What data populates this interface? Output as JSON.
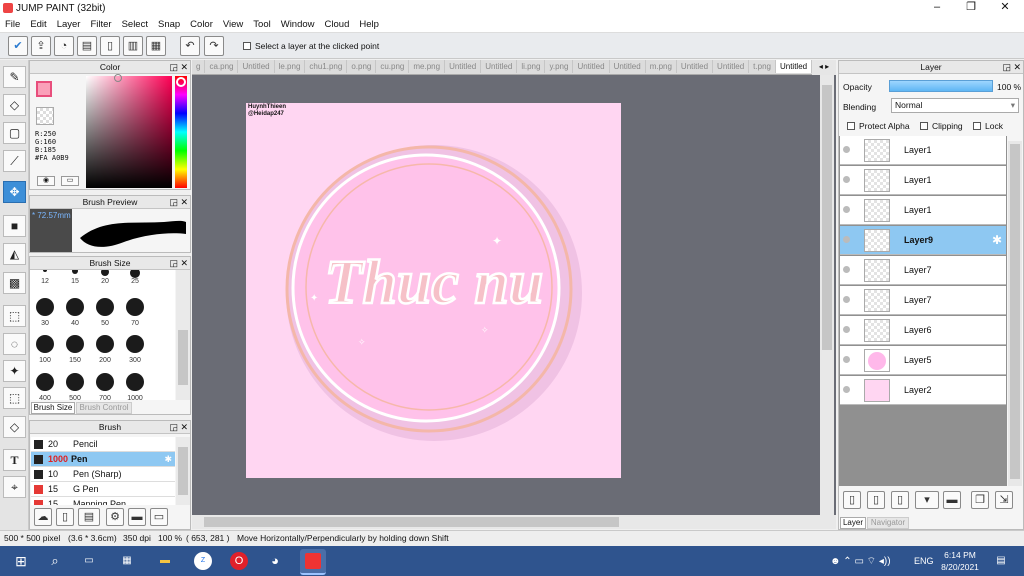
{
  "window": {
    "title": "JUMP PAINT (32bit)",
    "minimize": "–",
    "maximize": "❐",
    "close": "✕"
  },
  "menu": [
    "File",
    "Edit",
    "Layer",
    "Filter",
    "Select",
    "Snap",
    "Color",
    "View",
    "Tool",
    "Window",
    "Cloud",
    "Help"
  ],
  "toolbar": {
    "select_layer_label": "Select a layer at the clicked point"
  },
  "tabs": [
    "g",
    "ca.png",
    "Untitled",
    "le.png",
    "chu1.png",
    "o.png",
    "cu.png",
    "me.png",
    "Untitled",
    "Untitled",
    "li.png",
    "y.png",
    "Untitled",
    "Untitled",
    "m.png",
    "Untitled",
    "Untitled",
    "t.png",
    "Untitled"
  ],
  "color_panel": {
    "title": "Color",
    "r": "R:250",
    "g": "G:160",
    "b": "B:185",
    "hex": "#FA A0B9",
    "fg": "#FAA0B9"
  },
  "brush_preview": {
    "title": "Brush Preview",
    "size": "72.57mm"
  },
  "brush_size": {
    "title": "Brush Size",
    "rows": [
      [
        "12",
        "15",
        "20",
        "25"
      ],
      [
        "30",
        "40",
        "50",
        "70"
      ],
      [
        "100",
        "150",
        "200",
        "300"
      ],
      [
        "400",
        "500",
        "700",
        "1000"
      ]
    ],
    "tab_size": "Brush Size",
    "tab_control": "Brush Control"
  },
  "brush": {
    "title": "Brush",
    "items": [
      {
        "size": "20",
        "name": "Pencil",
        "color": "#222222"
      },
      {
        "size": "1000",
        "name": "Pen",
        "color": "#222222",
        "selected": true
      },
      {
        "size": "10",
        "name": "Pen (Sharp)",
        "color": "#222222"
      },
      {
        "size": "15",
        "name": "G Pen",
        "color": "#e53935"
      },
      {
        "size": "15",
        "name": "Mapping Pen",
        "color": "#e53935"
      }
    ]
  },
  "canvas": {
    "watermark1": "HuynhThieen",
    "watermark2": "@Heidap247",
    "lettering": "Thuc nu"
  },
  "layer_panel": {
    "title": "Layer",
    "opacity_label": "Opacity",
    "opacity_value": "100 %",
    "blending_label": "Blending",
    "blending_value": "Normal",
    "protect_alpha": "Protect Alpha",
    "clipping": "Clipping",
    "lock": "Lock",
    "layers": [
      {
        "name": "Layer1",
        "thumb": "checker"
      },
      {
        "name": "Layer1",
        "thumb": "checker"
      },
      {
        "name": "Layer1",
        "thumb": "checker"
      },
      {
        "name": "Layer9",
        "thumb": "checker",
        "selected": true
      },
      {
        "name": "Layer7",
        "thumb": "checker"
      },
      {
        "name": "Layer7",
        "thumb": "checker"
      },
      {
        "name": "Layer6",
        "thumb": "checker"
      },
      {
        "name": "Layer5",
        "thumb": "circle"
      },
      {
        "name": "Layer2",
        "thumb": "pink"
      }
    ],
    "tab_layer": "Layer",
    "tab_navigator": "Navigator"
  },
  "status": {
    "size": "500 * 500 pixel",
    "mm": "(3.6 * 3.6cm)",
    "dpi": "350 dpi",
    "zoom": "100 %",
    "coords": "( 653, 281 )",
    "hint": "Move Horizontally/Perpendicularly by holding down Shift"
  },
  "taskbar": {
    "ime": "ENG",
    "time": "6:14 PM",
    "date": "8/20/2021"
  },
  "colors": {
    "accent": "#3d8fd8",
    "selection": "#8ec8f2",
    "canvas_bg": "#ffd6f2",
    "taskbar": "#2f548e"
  }
}
